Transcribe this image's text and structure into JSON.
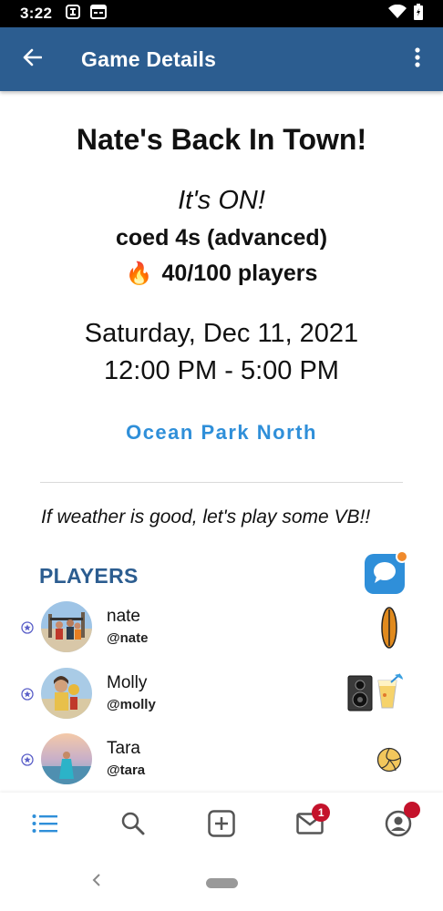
{
  "status_bar": {
    "time": "3:22"
  },
  "app_bar": {
    "title": "Game Details"
  },
  "game": {
    "title": "Nate's Back In Town!",
    "status": "It's ON!",
    "type": "coed 4s (advanced)",
    "player_count": "40/100 players",
    "date": "Saturday, Dec 11, 2021",
    "time": "12:00 PM - 5:00 PM",
    "location": "Ocean Park North",
    "description": "If weather is good, let's play some VB!!"
  },
  "players_section": {
    "header": "PLAYERS",
    "players": [
      {
        "name": "nate",
        "handle": "@nate",
        "items": [
          "surfboard-icon"
        ]
      },
      {
        "name": "Molly",
        "handle": "@molly",
        "items": [
          "speaker-icon",
          "cocktail-icon"
        ]
      },
      {
        "name": "Tara",
        "handle": "@tara",
        "items": [
          "volleyball-icon"
        ]
      }
    ]
  },
  "bottom_nav": {
    "items": [
      "list-icon",
      "search-icon",
      "add-icon",
      "mail-icon",
      "profile-icon"
    ],
    "mail_badge": "1"
  },
  "colors": {
    "app_bar": "#2c5d90",
    "accent": "#2f8fd9",
    "badge": "#c4122b"
  }
}
